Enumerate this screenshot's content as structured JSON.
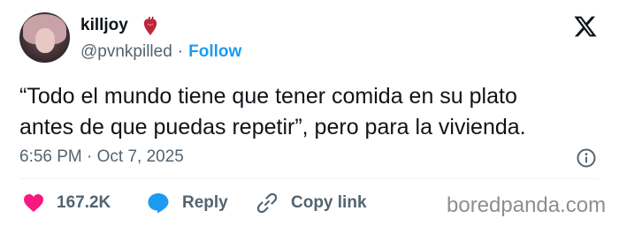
{
  "author": {
    "name": "killjoy",
    "name_emoji": "anatomical-heart-icon",
    "handle": "@pvnkpilled",
    "separator": "·",
    "follow_label": "Follow"
  },
  "tweet": {
    "text_lines": [
      "“Todo el mundo tiene que tener comida en su plato",
      "antes de que puedas repetir”, pero para la vivienda."
    ],
    "timestamp": "6:56 PM · Oct 7, 2025"
  },
  "actions": {
    "like_count": "167.2K",
    "reply_label": "Reply",
    "copy_label": "Copy link"
  },
  "watermark": "boredpanda.com",
  "colors": {
    "accent": "#1d9bf0",
    "like": "#f91880",
    "text": "#0f1419",
    "muted": "#536471"
  }
}
